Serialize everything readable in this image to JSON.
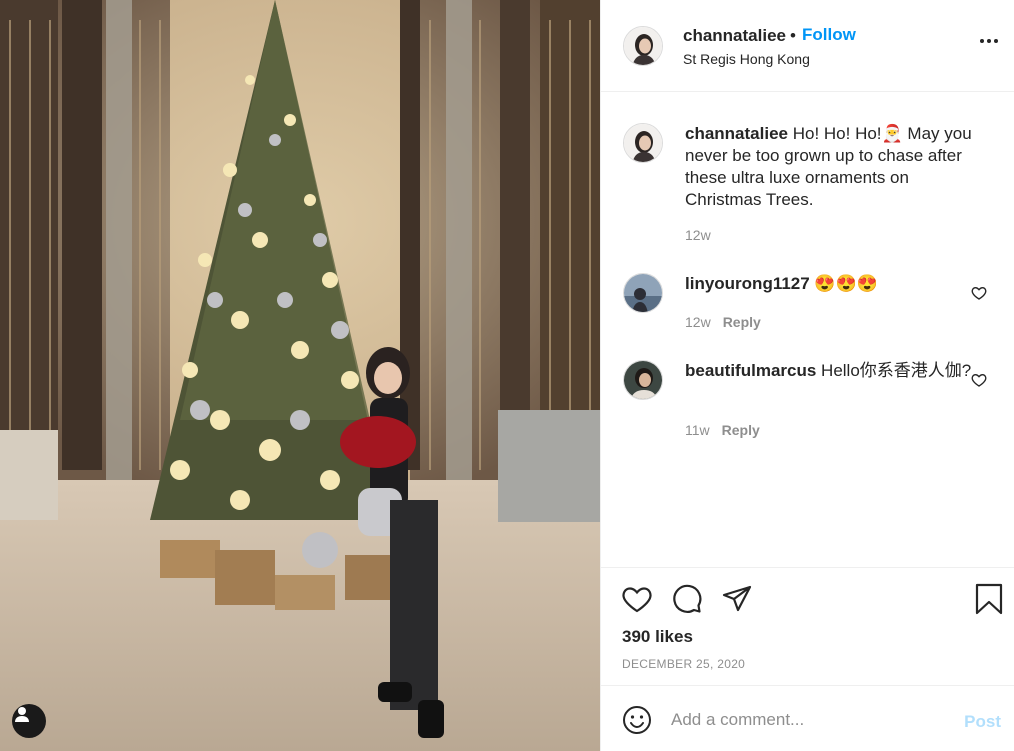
{
  "photo": {
    "alt_icon": "user-tag-icon"
  },
  "header": {
    "username": "channataliee",
    "dot": "•",
    "follow_label": "Follow",
    "location": "St Regis Hong Kong",
    "more_icon": "more-options-icon"
  },
  "caption": {
    "username": "channataliee",
    "text": " Ho! Ho! Ho!🎅 May you never be too grown up to chase after these ultra luxe ornaments on Christmas Trees.",
    "age": "12w"
  },
  "comments": [
    {
      "username": "linyourong1127",
      "text": " 😍😍😍",
      "age": "12w",
      "reply_label": "Reply"
    },
    {
      "username": "beautifulmarcus",
      "text": " Hello你系香港人伽?",
      "age": "11w",
      "reply_label": "Reply"
    }
  ],
  "actions": {
    "like_icon": "heart-icon",
    "comment_icon": "comment-icon",
    "share_icon": "share-icon",
    "save_icon": "bookmark-icon",
    "likes": "390 likes",
    "date": "DECEMBER 25, 2020"
  },
  "compose": {
    "emoji_icon": "emoji-icon",
    "placeholder": "Add a comment...",
    "post_label": "Post"
  },
  "colors": {
    "accent": "#0095f6",
    "post_disabled": "#b2dffc",
    "muted": "#8e8e8e",
    "text": "#262626",
    "border": "#efefef"
  }
}
